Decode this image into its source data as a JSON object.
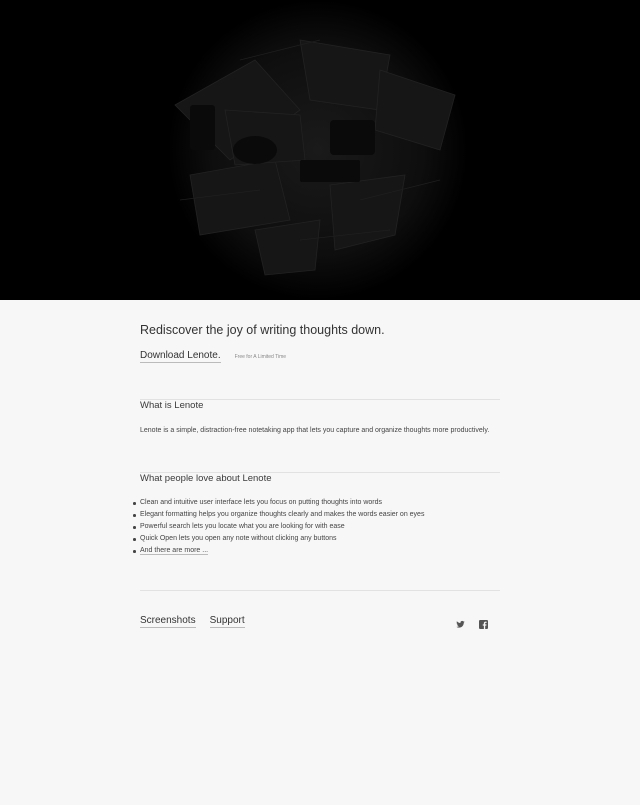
{
  "hero": {
    "image": "desk-collage-dark"
  },
  "main": {
    "tagline": "Rediscover the joy of writing thoughts down.",
    "download_label": "Download Lenote.",
    "download_note": "Free for A Limited Time"
  },
  "about": {
    "title": "What is Lenote",
    "body": "Lenote is a simple, distraction-free notetaking app that lets you capture and organize thoughts more productively."
  },
  "features": {
    "title": "What people love about Lenote",
    "items": [
      "Clean and intuitive user interface lets you focus on putting thoughts into words",
      "Elegant formatting helps you organize thoughts clearly and makes the words easier on eyes",
      "Powerful search lets you locate what you are looking for with ease",
      "Quick Open lets you open any note without clicking any buttons"
    ],
    "more_label": "And there are more ..."
  },
  "footer": {
    "links": [
      "Screenshots",
      "Support"
    ],
    "social_icons": [
      "twitter-icon",
      "facebook-icon"
    ]
  },
  "colors": {
    "hero_bg": "#000000",
    "page_bg": "#f7f7f7",
    "text": "#3a3a3a",
    "divider": "#e2e2e2"
  }
}
